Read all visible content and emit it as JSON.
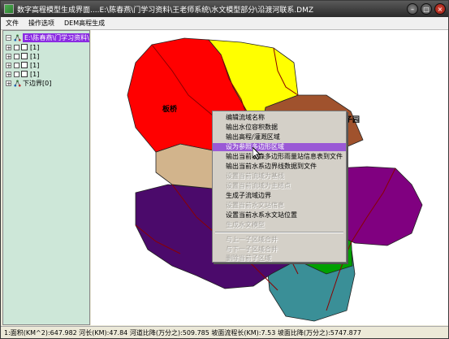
{
  "window": {
    "title": "数字高程模型生成界面....E:\\陈春燕\\门学习资料\\王老师系统\\水文模型部分\\沿渡河联系.DMZ"
  },
  "menu": [
    "文件",
    "操作选项",
    "DEM高程生成"
  ],
  "tree": {
    "root_label": "E:\\陈春燕\\门学习资料\\王",
    "layers": [
      {
        "label": "[1]"
      },
      {
        "label": "[1]"
      },
      {
        "label": "[1]"
      },
      {
        "label": "[1]"
      }
    ],
    "lower_node_label": "下边界[0]"
  },
  "map": {
    "labels": {
      "banqiao": "板桥",
      "zi_yuan": "子园"
    },
    "colors": {
      "red": "#ff0000",
      "yellow": "#ffff00",
      "brown": "#a0522d",
      "tan": "#d2b48c",
      "purple": "#4b0a6b",
      "magenta": "#800080",
      "teal": "#3a8f97",
      "green": "#00a000"
    }
  },
  "context_menu": {
    "items": [
      {
        "label": "编辑流域名称",
        "disabled": false
      },
      {
        "label": "输出水位容积数据",
        "disabled": false
      },
      {
        "label": "输出高程/灌溉区域",
        "disabled": false
      },
      {
        "label": "设为参照多边形区域",
        "disabled": false,
        "highlighted": true
      },
      {
        "label": "输出当前泰森多边形雨量站信息表到文件",
        "disabled": false
      },
      {
        "label": "输出当前水系边界线数据到文件",
        "disabled": false
      },
      {
        "label": "设置当前流域为基线",
        "disabled": true
      },
      {
        "label": "设置当前流域为主结点",
        "disabled": true
      },
      {
        "label": "生成子流域边界",
        "disabled": false
      },
      {
        "label": "设置当前水文站信息",
        "disabled": true
      },
      {
        "label": "设置当前水系水文站位置",
        "disabled": false
      },
      {
        "label": "生成水文模型",
        "disabled": true
      },
      {
        "label": "与上一子区域合并",
        "disabled": true
      },
      {
        "label": "与下一子区域合并",
        "disabled": true
      },
      {
        "label": "删除当前子区域",
        "disabled": true
      }
    ]
  },
  "status": {
    "text": "1:面积(KM^2):647.982 河长(KM):47.84 河道比降(万分之):509.785 坡面流程长(KM):7.53 坡面比降(万分之):5747.877"
  }
}
